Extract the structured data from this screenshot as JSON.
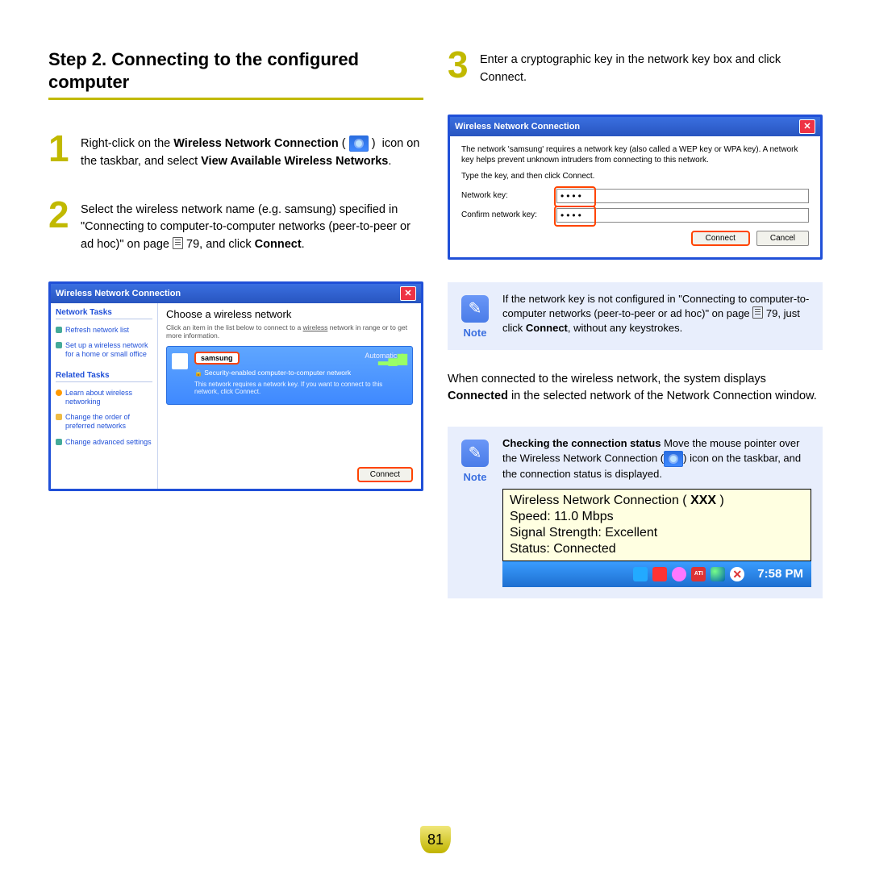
{
  "title": "Step 2. Connecting to the configured computer",
  "page_number": "81",
  "steps": {
    "s1": {
      "num": "1",
      "pre": "Right-click on the ",
      "bold1": "Wireless Network Connection",
      "mid": "icon on the taskbar, and select ",
      "bold2": "View Available Wireless Networks",
      "end": "."
    },
    "s2": {
      "num": "2",
      "t1": "Select the wireless network name (e.g. samsung) specified in \"Connecting to computer-to-computer networks (peer-to-peer or ad hoc)\" on page ",
      "pg": "79",
      "t2": ", and click ",
      "bold": "Connect",
      "end": "."
    },
    "s3": {
      "num": "3",
      "text": "Enter a cryptographic key in the network key box and click Connect."
    }
  },
  "shot1": {
    "title": "Wireless Network Connection",
    "side": {
      "h1": "Network Tasks",
      "l1": "Refresh network list",
      "l2": "Set up a wireless network for a home or small office",
      "h2": "Related Tasks",
      "l3": "Learn about wireless networking",
      "l4": "Change the order of preferred networks",
      "l5": "Change advanced settings"
    },
    "heading": "Choose a wireless network",
    "sub_a": "Click an item in the list below to connect to a ",
    "sub_u": "wireless",
    "sub_b": " network in range or to get more information.",
    "net_name": "samsung",
    "auto": "Automatic",
    "secure": "Security-enabled computer-to-computer network",
    "desc": "This network requires a network key. If you want to connect to this network, click Connect.",
    "connect": "Connect"
  },
  "shot2": {
    "title": "Wireless Network Connection",
    "desc": "The network 'samsung' requires a network key (also called a WEP key or WPA key). A network key helps prevent unknown intruders from connecting to this network.",
    "hint": "Type the key, and then click Connect.",
    "label1": "Network key:",
    "label2": "Confirm network key:",
    "val": "••••",
    "connect": "Connect",
    "cancel": "Cancel"
  },
  "note1": {
    "label": "Note",
    "t1": "If the network key is not configured in \"Connecting to computer-to-computer networks (peer-to-peer or ad hoc)\" on page ",
    "pg": "79",
    "t2": ", just click ",
    "bold": "Connect",
    "t3": ", without any keystrokes."
  },
  "para": {
    "t1": "When connected to the wireless network, the system displays ",
    "bold": "Connected",
    "t2": " in the selected network of the Network Connection window."
  },
  "note2": {
    "label": "Note",
    "bold": "Checking the connection status",
    "t1": " Move the mouse pointer over the Wireless Network Connection (",
    "t2": ") icon on the taskbar, and the connection status is displayed."
  },
  "tooltip": {
    "l1_a": "Wireless Network Connection ( ",
    "l1_b": "XXX",
    "l1_c": " )",
    "l2": "Speed: 11.0 Mbps",
    "l3": "Signal Strength: Excellent",
    "l4": "Status:  Connected"
  },
  "clock": "7:58 PM"
}
